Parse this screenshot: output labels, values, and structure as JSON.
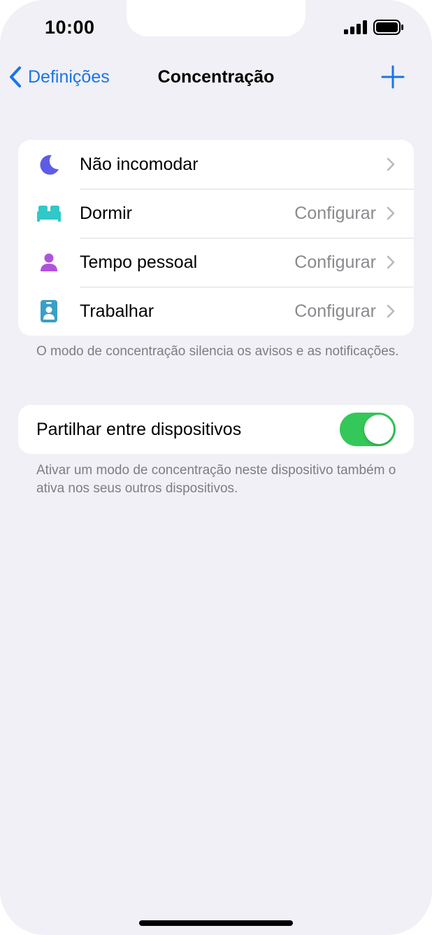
{
  "status_bar": {
    "time": "10:00"
  },
  "nav": {
    "back_label": "Definições",
    "title": "Concentração"
  },
  "modes": [
    {
      "label": "Não incomodar",
      "value": "",
      "icon": "moon-icon",
      "color": "#5e5ce6"
    },
    {
      "label": "Dormir",
      "value": "Configurar",
      "icon": "bed-icon",
      "color": "#30c8c8"
    },
    {
      "label": "Tempo pessoal",
      "value": "Configurar",
      "icon": "person-icon",
      "color": "#af52de"
    },
    {
      "label": "Trabalhar",
      "value": "Configurar",
      "icon": "id-badge-icon",
      "color": "#3a9fc6"
    }
  ],
  "modes_footnote": "O modo de concentração silencia os avisos e as notificações.",
  "share": {
    "label": "Partilhar entre dispositivos",
    "enabled": true,
    "footnote": "Ativar um modo de concentração neste dispositivo também o ativa nos seus outros dispositivos."
  },
  "colors": {
    "accent": "#1a74e8",
    "toggle_on": "#34c759",
    "background": "#f0f0f6"
  }
}
